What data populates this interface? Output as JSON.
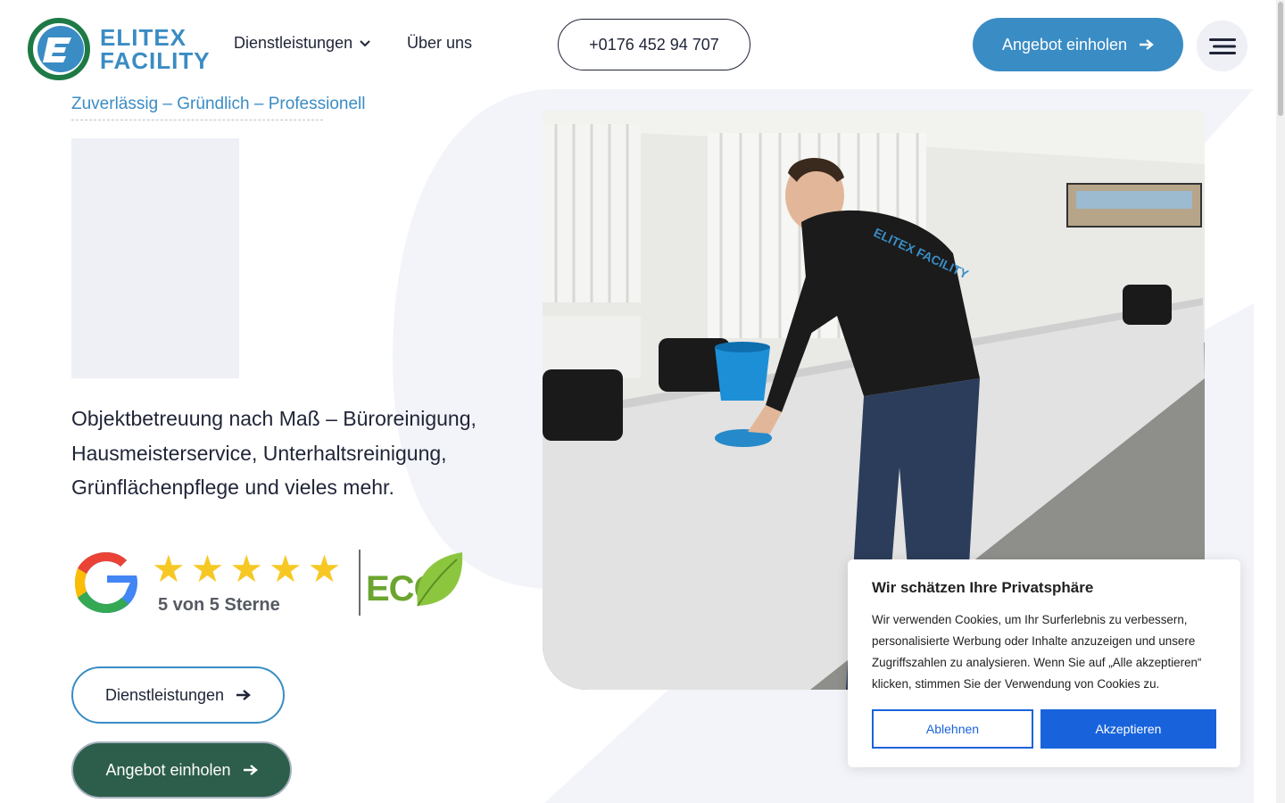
{
  "brand": {
    "name_line1": "ELITEX",
    "name_line2": "FACILITY",
    "accent": "#3a8cc4",
    "dark_green": "#2d5e4b"
  },
  "header": {
    "nav_services": "Dienstleistungen",
    "nav_about": "Über uns",
    "phone": "+0176 452 94 707",
    "cta": "Angebot einholen",
    "menu_icon": "hamburger-icon"
  },
  "hero": {
    "tagline": "Zuverlässig – Gründlich – Professionell",
    "description": "Objektbetreuung nach Maß – Büroreinigung, Hausmeisterservice, Unterhaltsreinigung, Grünflächenpflege und vieles mehr.",
    "rating": {
      "stars": 5,
      "text": "5 von 5 Sterne",
      "eco_label": "ECO"
    },
    "btn_services": "Dienstleistungen",
    "btn_offer": "Angebot einholen",
    "photo_shirt_brand": "ELITEX FACILITY"
  },
  "cookie": {
    "title": "Wir schätzen Ihre Privatsphäre",
    "body": "Wir verwenden Cookies, um Ihr Surferlebnis zu verbessern, personalisierte Werbung oder Inhalte anzuzeigen und unsere Zugriffszahlen zu analysieren. Wenn Sie auf „Alle akzeptieren“ klicken, stimmen Sie der Verwendung von Cookies zu.",
    "decline": "Ablehnen",
    "accept": "Akzeptieren",
    "accent": "#1863dc"
  }
}
